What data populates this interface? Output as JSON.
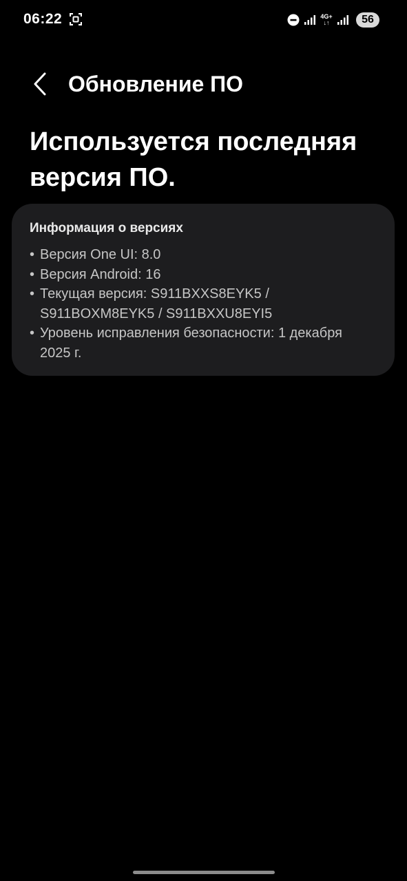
{
  "status_bar": {
    "time": "06:22",
    "network": "4G+",
    "battery": "56"
  },
  "header": {
    "title": "Обновление ПО"
  },
  "main": {
    "heading": "Используется последняя версия ПО."
  },
  "info_card": {
    "title": "Информация о версиях",
    "items": [
      {
        "bullet": "•",
        "text": "Версия One UI: 8.0"
      },
      {
        "bullet": "•",
        "text": "Версия Android: 16"
      },
      {
        "bullet": "•",
        "text": "Текущая версия: S911BXXS8EYK5 / S911BOXM8EYK5 / S911BXXU8EYI5"
      },
      {
        "bullet": "•",
        "text": "Уровень исправления безопасности: 1 декабря 2025 г."
      }
    ]
  },
  "colors": {
    "background": "#000000",
    "card": "#1d1d1f",
    "text_primary": "#ffffff",
    "text_secondary": "#c6c6c6"
  },
  "icons": {
    "back": "chevron-left-icon",
    "screenshot": "screenshot-icon",
    "dnd": "do-not-disturb-icon",
    "signal": "signal-icon"
  }
}
